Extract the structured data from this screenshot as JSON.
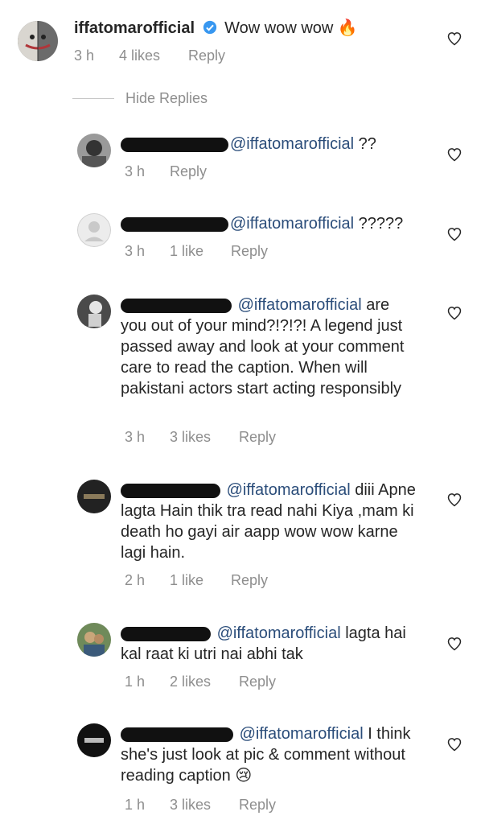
{
  "main_comment": {
    "username": "iffatomarofficial",
    "text": "Wow wow wow 🔥",
    "time": "3 h",
    "likes": "4 likes",
    "reply": "Reply"
  },
  "hide_replies": "Hide Replies",
  "replies": [
    {
      "mention": "@iffatomarofficial",
      "text": " ??",
      "time": "3 h",
      "likes": "",
      "reply": "Reply"
    },
    {
      "mention": "@iffatomarofficial",
      "text": " ?????",
      "time": "3 h",
      "likes": "1 like",
      "reply": "Reply"
    },
    {
      "mention": "@iffatomarofficial",
      "text": " are you out of your mind?!?!?! A legend just passed away and look at your comment care to read the caption. When will pakistani actors start acting responsibly",
      "time": "3 h",
      "likes": "3 likes",
      "reply": "Reply"
    },
    {
      "mention": "@iffatomarofficial",
      "text": " diii Apne lagta Hain thik tra read nahi Kiya ,mam ki death ho gayi air aapp wow wow karne lagi hain.",
      "time": "2 h",
      "likes": "1 like",
      "reply": "Reply"
    },
    {
      "mention": "@iffatomarofficial",
      "text": " lagta hai kal raat ki utri nai abhi tak",
      "time": "1 h",
      "likes": "2 likes",
      "reply": "Reply"
    },
    {
      "mention": "@iffatomarofficial",
      "text": " I think she's just look at pic & comment without reading caption 😢",
      "time": "1 h",
      "likes": "3 likes",
      "reply": "Reply"
    }
  ]
}
